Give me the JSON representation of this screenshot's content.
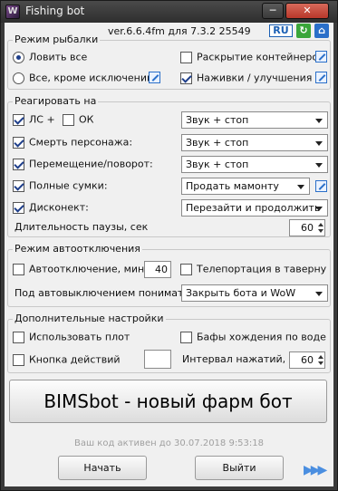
{
  "window": {
    "title": "Fishing bot",
    "min_label": "─",
    "close_label": "✕"
  },
  "header": {
    "version": "ver.6.6.4fm для 7.3.2 25549",
    "lang": "RU",
    "refresh_icon_glyph": "↻",
    "home_icon_glyph": "⌂"
  },
  "fishing_mode": {
    "legend": "Режим рыбалки",
    "catch_all": {
      "label": "Ловить все",
      "selected": true
    },
    "all_except": {
      "label": "Все, кроме исключений",
      "selected": false
    },
    "open_containers": {
      "label": "Раскрытие контейнеров",
      "checked": false
    },
    "baits": {
      "label": "Наживки / улучшения",
      "checked": true
    }
  },
  "react": {
    "legend": "Реагировать на",
    "ls": {
      "label": "ЛС +",
      "checked": true
    },
    "ok": {
      "label": "ОК",
      "checked": false
    },
    "death": {
      "label": "Смерть персонажа:",
      "checked": true
    },
    "move": {
      "label": "Перемещение/поворот:",
      "checked": true
    },
    "bags": {
      "label": "Полные сумки:",
      "checked": true
    },
    "disconnect": {
      "label": "Дисконект:",
      "checked": true
    },
    "pause_label": "Длительность паузы, сек",
    "pause_value": "60",
    "select_ls": "Звук + стоп",
    "select_death": "Звук + стоп",
    "select_move": "Звук + стоп",
    "select_bags": "Продать мамонту",
    "select_disconnect": "Перезайти и продолжить"
  },
  "autooff": {
    "legend": "Режим автоотключения",
    "auto_off": {
      "label": "Автоотключение, мин:",
      "checked": false
    },
    "minutes": "40",
    "teleport": {
      "label": "Телепортация в таверну",
      "checked": false
    },
    "meaning_label": "Под автовыключением понимать",
    "meaning_select": "Закрыть бота и WoW"
  },
  "extra": {
    "legend": "Дополнительные настройки",
    "raft": {
      "label": "Использовать плот",
      "checked": false
    },
    "water_walk": {
      "label": "Бафы хождения по воде",
      "checked": false
    },
    "action_button": {
      "label": "Кнопка действий",
      "checked": false
    },
    "action_key": "",
    "interval_label": "Интервал нажатий, с",
    "interval_value": "60"
  },
  "banner": "BIMSbot - новый фарм бот",
  "status": "Ваш код активен до 30.07.2018 9:53:18",
  "buttons": {
    "start": "Начать",
    "exit": "Выйти"
  },
  "colors": {
    "accent": "#1e3e8a",
    "link": "#2a6fc9",
    "refresh": "#3aa63a"
  }
}
